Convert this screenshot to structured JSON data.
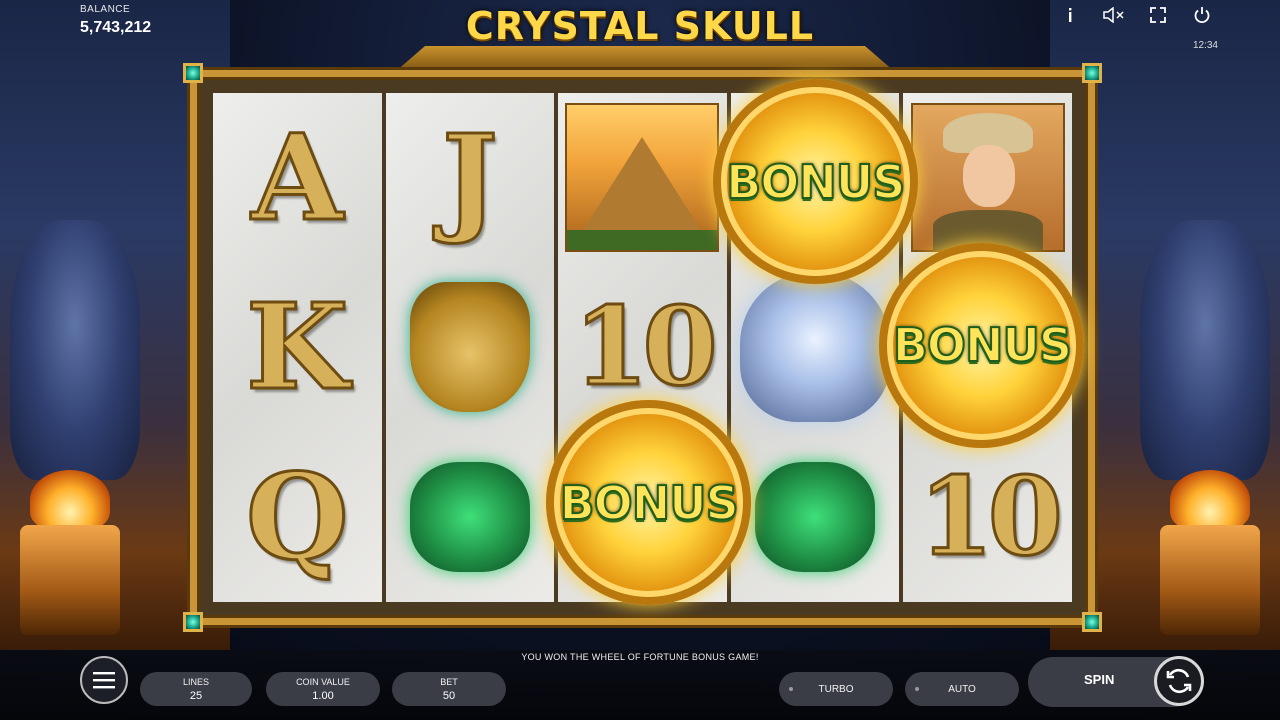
{
  "header": {
    "balance_label": "BALANCE",
    "balance_value": "5,743,212",
    "game_title": "CRYSTAL SKULL",
    "clock": "12:34",
    "icons": [
      "info-icon",
      "sound-muted-icon",
      "fullscreen-icon",
      "power-icon"
    ]
  },
  "reels": {
    "reel1": [
      "A",
      "K",
      "Q"
    ],
    "reel2": [
      "J",
      "mask",
      "serpent"
    ],
    "reel3": [
      "pyramid",
      "10",
      "BONUS"
    ],
    "reel4": [
      "BONUS",
      "skull",
      "serpent"
    ],
    "reel5": [
      "explorer",
      "BONUS",
      "10"
    ],
    "bonus_label": "BONUS",
    "ten_label": "10"
  },
  "bottom": {
    "message": "YOU WON THE WHEEL OF FORTUNE BONUS GAME!",
    "lines_label": "LINES",
    "lines_value": "25",
    "coin_label": "COIN VALUE",
    "coin_value": "1.00",
    "bet_label": "BET",
    "bet_value": "50",
    "turbo_label": "TURBO",
    "auto_label": "AUTO",
    "spin_label": "SPIN"
  },
  "colors": {
    "gold": "#d7b05a",
    "title": "#ffd84a",
    "bonus_text": "#ffe45a",
    "bar": "#3a3d46"
  }
}
